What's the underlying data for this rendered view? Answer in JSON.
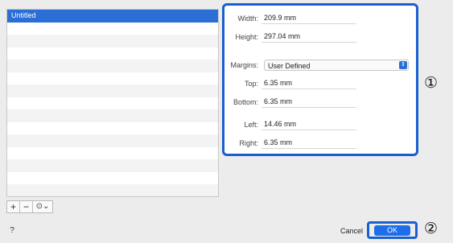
{
  "list": {
    "items": [
      "Untitled",
      "",
      "",
      "",
      "",
      "",
      "",
      "",
      "",
      "",
      "",
      "",
      "",
      "",
      ""
    ]
  },
  "toolbar": {
    "add_label": "+",
    "remove_label": "−",
    "options_label": "⊙⌄"
  },
  "panel": {
    "width_label": "Width:",
    "width_value": "209.9 mm",
    "height_label": "Height:",
    "height_value": "297.04 mm",
    "margins_label": "Margins:",
    "margins_value": "User Defined",
    "top_label": "Top:",
    "top_value": "6.35 mm",
    "bottom_label": "Bottom:",
    "bottom_value": "6.35 mm",
    "left_label": "Left:",
    "left_value": "14.46 mm",
    "right_label": "Right:",
    "right_value": "6.35 mm"
  },
  "callouts": {
    "one": "①",
    "two": "②"
  },
  "footer": {
    "help": "?",
    "cancel_label": "Cancel",
    "ok_label": "OK"
  },
  "colors": {
    "accent": "#1a5fd0",
    "selection": "#2b6fd6",
    "ok": "#1d6ee8"
  }
}
